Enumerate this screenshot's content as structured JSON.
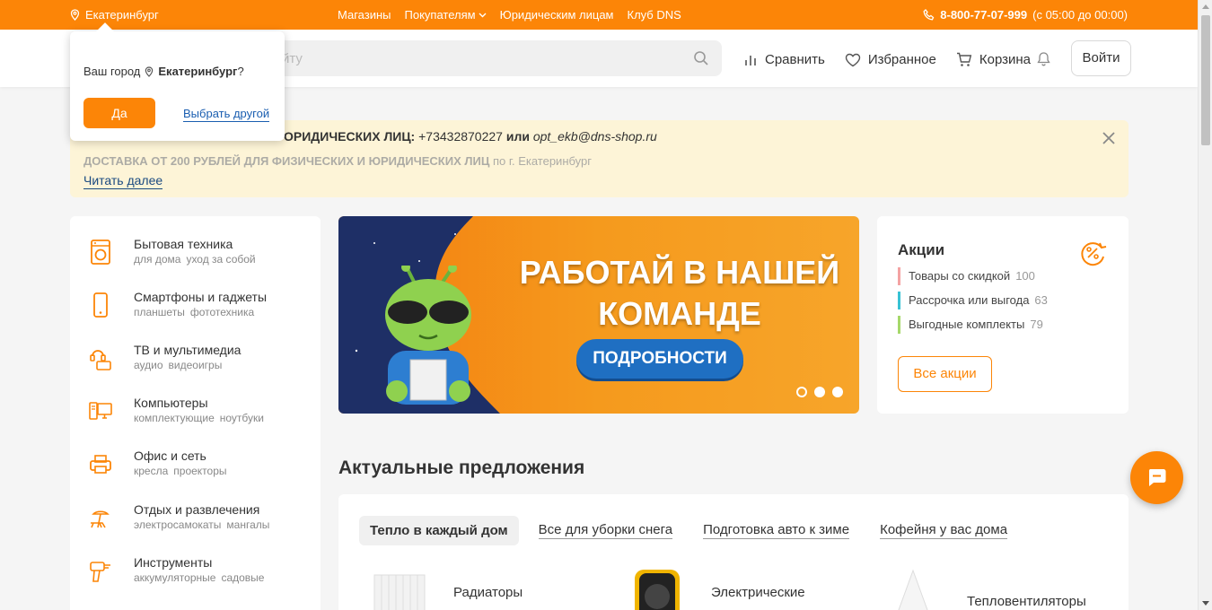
{
  "topbar": {
    "city": "Екатеринбург",
    "nav": [
      "Магазины",
      "Покупателям",
      "Юридическим лицам",
      "Клуб DNS"
    ],
    "phone": "8-800-77-07-999",
    "hours": "(с 05:00 до 00:00)"
  },
  "header": {
    "search_placeholder": "йту",
    "compare": "Сравнить",
    "favorites": "Избранное",
    "cart": "Корзина",
    "login": "Войти"
  },
  "city_popup": {
    "question_prefix": "Ваш город",
    "city": "Екатеринбург",
    "question_suffix": "?",
    "yes": "Да",
    "choose_other": "Выбрать другой"
  },
  "notice": {
    "line1_bold": "ОРИДИЧЕСКИХ ЛИЦ:",
    "line1_phone": "+73432870227",
    "line1_or": "или",
    "line1_email": "opt_ekb@dns-shop.ru",
    "line2_bold": "ДОСТАВКА ОТ 200 РУБЛЕЙ ДЛЯ ФИЗИЧЕСКИХ И ЮРИДИЧЕСКИХ ЛИЦ",
    "line2_rest": "по г. Екатеринбург",
    "read_more": "Читать далее"
  },
  "catalog": [
    {
      "title": "Бытовая техника",
      "subs": [
        "для дома",
        "уход за собой"
      ],
      "icon": "washing-machine-icon"
    },
    {
      "title": "Смартфоны и гаджеты",
      "subs": [
        "планшеты",
        "фототехника"
      ],
      "icon": "smartphone-icon"
    },
    {
      "title": "ТВ и мультимедиа",
      "subs": [
        "аудио",
        "видеоигры"
      ],
      "icon": "tv-multimedia-icon"
    },
    {
      "title": "Компьютеры",
      "subs": [
        "комплектующие",
        "ноутбуки"
      ],
      "icon": "computer-icon"
    },
    {
      "title": "Офис и сеть",
      "subs": [
        "кресла",
        "проекторы"
      ],
      "icon": "printer-icon"
    },
    {
      "title": "Отдых и развлечения",
      "subs": [
        "электросамокаты",
        "мангалы"
      ],
      "icon": "leisure-icon"
    },
    {
      "title": "Инструменты",
      "subs": [
        "аккумуляторные",
        "садовые"
      ],
      "icon": "drill-icon"
    }
  ],
  "banner": {
    "line1": "РАБОТАЙ В НАШЕЙ",
    "line2": "КОМАНДЕ",
    "button": "ПОДРОБНОСТИ"
  },
  "promo": {
    "title": "Акции",
    "items": [
      {
        "label": "Товары со скидкой",
        "count": "100",
        "color": "#f4a3a3"
      },
      {
        "label": "Рассрочка или выгода",
        "count": "63",
        "color": "#38c2d4"
      },
      {
        "label": "Выгодные комплекты",
        "count": "79",
        "color": "#a6d86a"
      }
    ],
    "all": "Все акции"
  },
  "offers": {
    "title": "Актуальные предложения",
    "tabs": [
      "Тепло в каждый дом",
      "Все для уборки снега",
      "Подготовка авто к зиме",
      "Кофейня у вас дома"
    ],
    "products": [
      "Радиаторы",
      "Электрические",
      "Тепловентиляторы"
    ]
  },
  "colors": {
    "accent": "#fc8507",
    "link": "#1a5eb0",
    "notice_bg": "#fdf4d7"
  }
}
